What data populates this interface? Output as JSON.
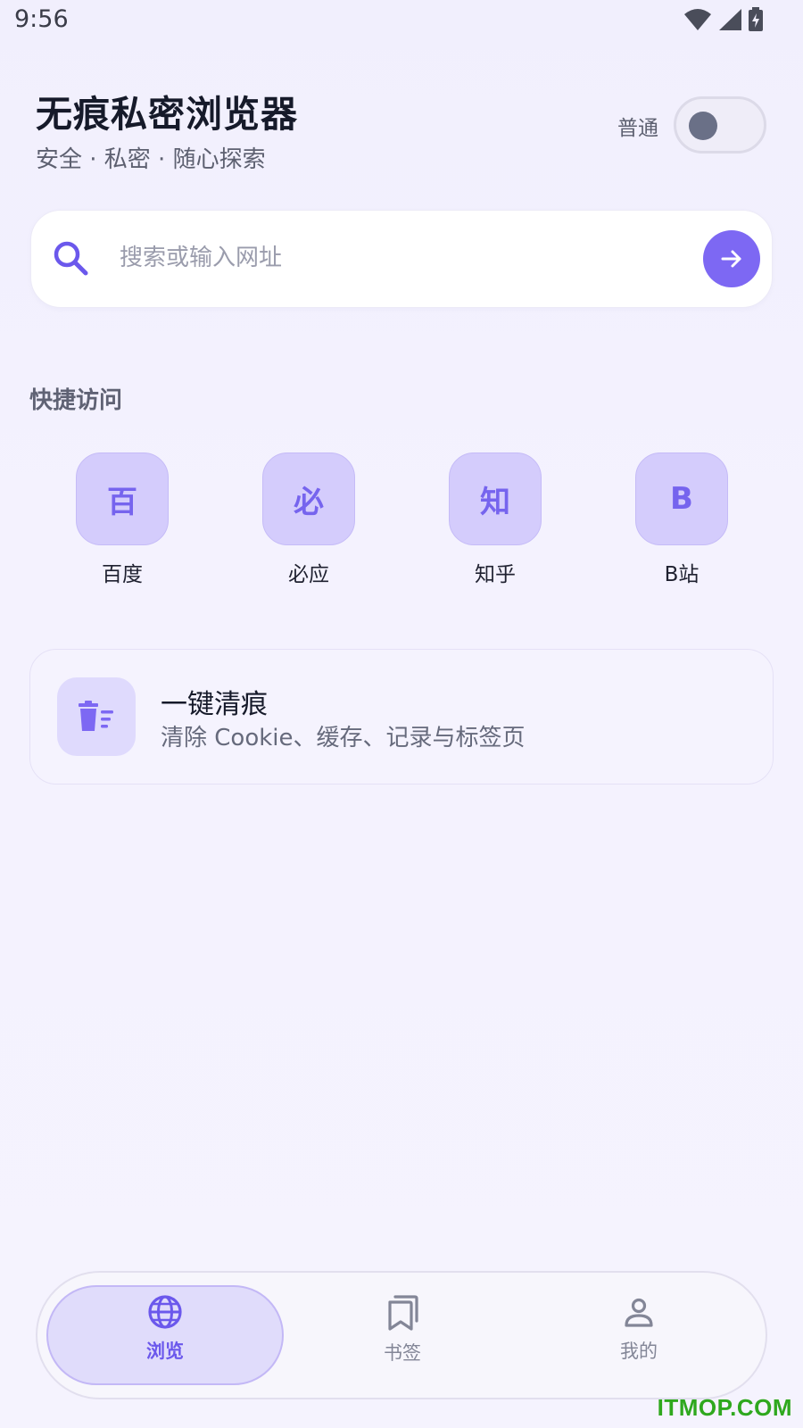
{
  "status_bar": {
    "time": "9:56",
    "icons": [
      "wifi-icon",
      "signal-icon",
      "battery-charging-icon"
    ]
  },
  "header": {
    "title": "无痕私密浏览器",
    "subtitle": "安全 · 私密 · 随心探索",
    "mode_label": "普通",
    "mode_toggle_on": false
  },
  "search": {
    "placeholder": "搜索或输入网址",
    "icon": "search-icon",
    "go_icon": "arrow-right-icon"
  },
  "quick_access": {
    "title": "快捷访问",
    "items": [
      {
        "glyph": "百",
        "label": "百度"
      },
      {
        "glyph": "必",
        "label": "必应"
      },
      {
        "glyph": "知",
        "label": "知乎"
      },
      {
        "glyph": "B",
        "label": "B站"
      }
    ]
  },
  "clear_card": {
    "icon": "clear-trash-icon",
    "title": "一键清痕",
    "description": "清除 Cookie、缓存、记录与标签页"
  },
  "bottom_nav": {
    "items": [
      {
        "label": "浏览",
        "icon": "globe-icon",
        "active": true
      },
      {
        "label": "书签",
        "icon": "bookmarks-icon",
        "active": false
      },
      {
        "label": "我的",
        "icon": "profile-icon",
        "active": false
      }
    ]
  },
  "watermark": "ITMOP.COM",
  "colors": {
    "accent": "#7d68f3",
    "tile_bg": "#d4ccfc",
    "background": "#f3f1fe"
  }
}
